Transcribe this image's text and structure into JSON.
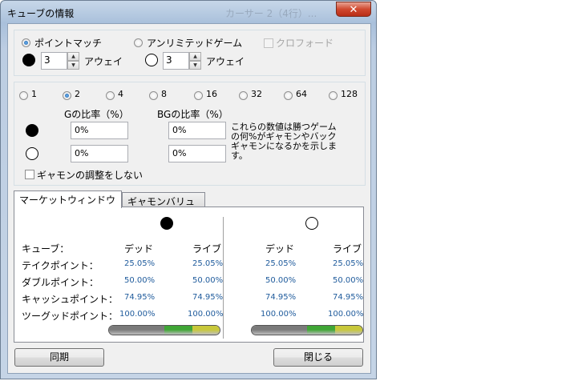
{
  "window": {
    "title": "キューブの情報",
    "background_title": "カーサー 2（4行）...",
    "close_glyph": "✕"
  },
  "match": {
    "point_match_label": "ポイントマッチ",
    "unlimited_label": "アンリミテッドゲーム",
    "crawford_label": "クロフォード",
    "black_away_value": "3",
    "white_away_value": "3",
    "away_label": "アウェイ",
    "selected": "point_match"
  },
  "cube": {
    "levels": [
      "1",
      "2",
      "4",
      "8",
      "16",
      "32",
      "64",
      "128"
    ],
    "selected": "2",
    "g_ratio_label": "Gの比率（%）",
    "bg_ratio_label": "BGの比率（%）",
    "black_g": "0%",
    "black_bg": "0%",
    "white_g": "0%",
    "white_bg": "0%",
    "note": [
      "これらの数値は勝つゲーム",
      "の何%がギャモンやバック",
      "ギャモンになるかを示しま",
      "す。"
    ],
    "no_gammon_adjust_label": "ギャモンの調整をしない"
  },
  "tabs": [
    {
      "label": "マーケットウィンドウ",
      "active": true
    },
    {
      "label": "ギャモンバリュー",
      "active": false
    }
  ],
  "market": {
    "row_labels": [
      "キューブ：",
      "テイクポイント：",
      "ダブルポイント：",
      "キャッシュポイント：",
      "ツーグッドポイント："
    ],
    "dead_label": "デッド",
    "live_label": "ライブ",
    "black": {
      "dead": [
        "25.05%",
        "50.00%",
        "74.95%",
        "100.00%"
      ],
      "live": [
        "25.05%",
        "50.00%",
        "74.95%",
        "100.00%"
      ]
    },
    "white": {
      "dead": [
        "25.05%",
        "50.00%",
        "74.95%",
        "100.00%"
      ],
      "live": [
        "25.05%",
        "50.00%",
        "74.95%",
        "100.00%"
      ]
    },
    "gauge_segments": [
      {
        "color": "#7a7a7a",
        "fraction": 0.5
      },
      {
        "color": "#3fa635",
        "fraction": 0.25
      },
      {
        "color": "#c8c83a",
        "fraction": 0.25
      }
    ]
  },
  "buttons": {
    "sync": "同期",
    "close": "閉じる"
  }
}
